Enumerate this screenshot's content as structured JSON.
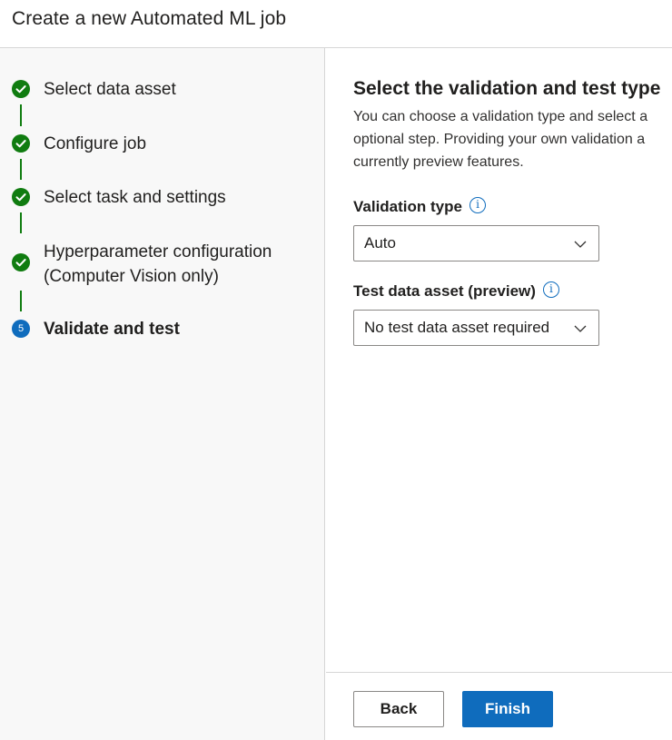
{
  "header": {
    "title": "Create a new Automated ML job"
  },
  "steps": [
    {
      "label": "Select data asset",
      "status": "done"
    },
    {
      "label": "Configure job",
      "status": "done"
    },
    {
      "label": "Select task and settings",
      "status": "done"
    },
    {
      "label_line1": "Hyperparameter configuration",
      "label_line2": "(Computer Vision only)",
      "status": "done"
    },
    {
      "label": "Validate and test",
      "status": "current",
      "number": "5"
    }
  ],
  "main": {
    "title": "Select the validation and test type",
    "description_lines": [
      "You can choose a validation type and select a",
      "optional step. Providing your own validation a",
      "currently preview features."
    ],
    "validation_type": {
      "label": "Validation type",
      "value": "Auto"
    },
    "test_data": {
      "label": "Test data asset (preview)",
      "value": "No test data asset required"
    }
  },
  "footer": {
    "back_label": "Back",
    "finish_label": "Finish"
  },
  "colors": {
    "done": "#107c10",
    "current": "#0f6cbd",
    "primary": "#0f6cbd"
  }
}
